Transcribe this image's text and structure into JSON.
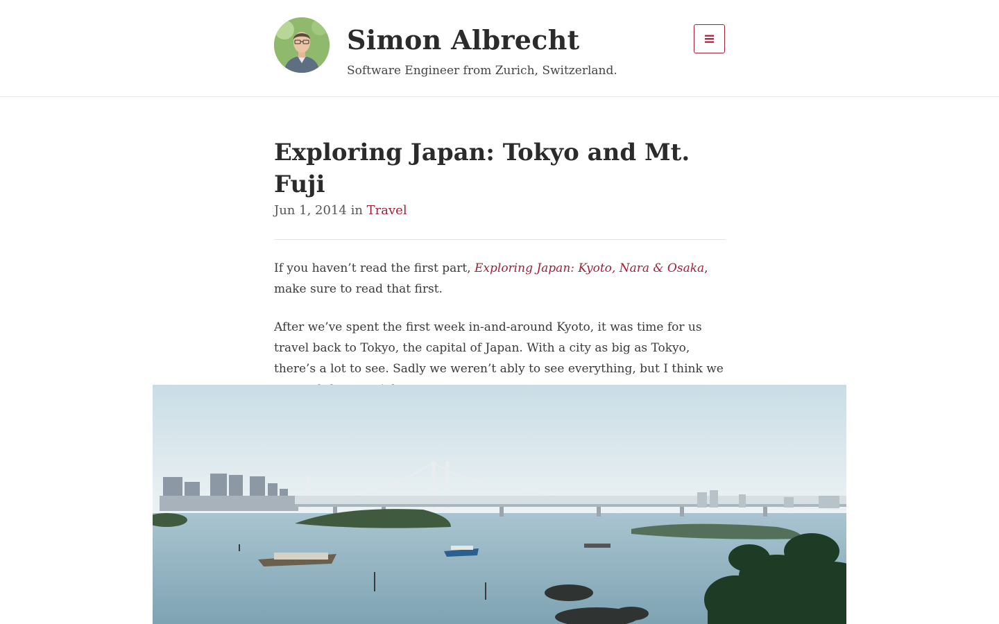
{
  "header": {
    "title": "Simon Albrecht",
    "tagline": "Software Engineer from Zurich, Switzerland.",
    "menu_icon": "hamburger-menu-icon",
    "avatar_alt": "Simon Albrecht"
  },
  "post": {
    "title": "Exploring Japan: Tokyo and Mt. Fuji",
    "date": "Jun 1, 2014",
    "in_word": "in",
    "category": "Travel",
    "para1_before": "If you haven’t read the first part, ",
    "para1_link": "Exploring Japan: Kyoto, Nara & Osaka",
    "para1_after": ", make sure to read that first.",
    "para2": "After we’ve spent the first week in-and-around Kyoto, it was time for us travel back to Tokyo, the capital of Japan. With a city as big as Tokyo, there’s a lot to see. Sadly we weren’t ably to see everything, but I think we covered the esential ones."
  },
  "colors": {
    "accent": "#a31f34",
    "text": "#3a3a3a",
    "divider": "#e3e3e3"
  }
}
